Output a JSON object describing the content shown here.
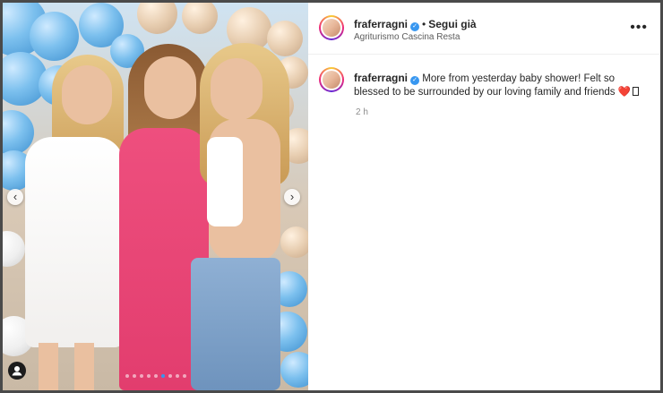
{
  "post": {
    "username": "fraferragni",
    "follow_separator": "•",
    "follow_label": "Segui già",
    "location": "Agriturismo Cascina Resta",
    "more_icon": "more-horizontal-icon",
    "caption_text": "More from yesterday baby shower! Felt so blessed to be surrounded by our loving family and friends",
    "caption_heart": "❤️",
    "time": "2 h"
  },
  "carousel": {
    "prev_icon": "‹",
    "next_icon": "›",
    "dot_count": 9,
    "active_dot": 5
  },
  "colors": {
    "accent": "#3797f0",
    "verified": "#3897f0",
    "heart": "#ed4956",
    "text": "#262626",
    "muted": "#8e8e8e"
  }
}
